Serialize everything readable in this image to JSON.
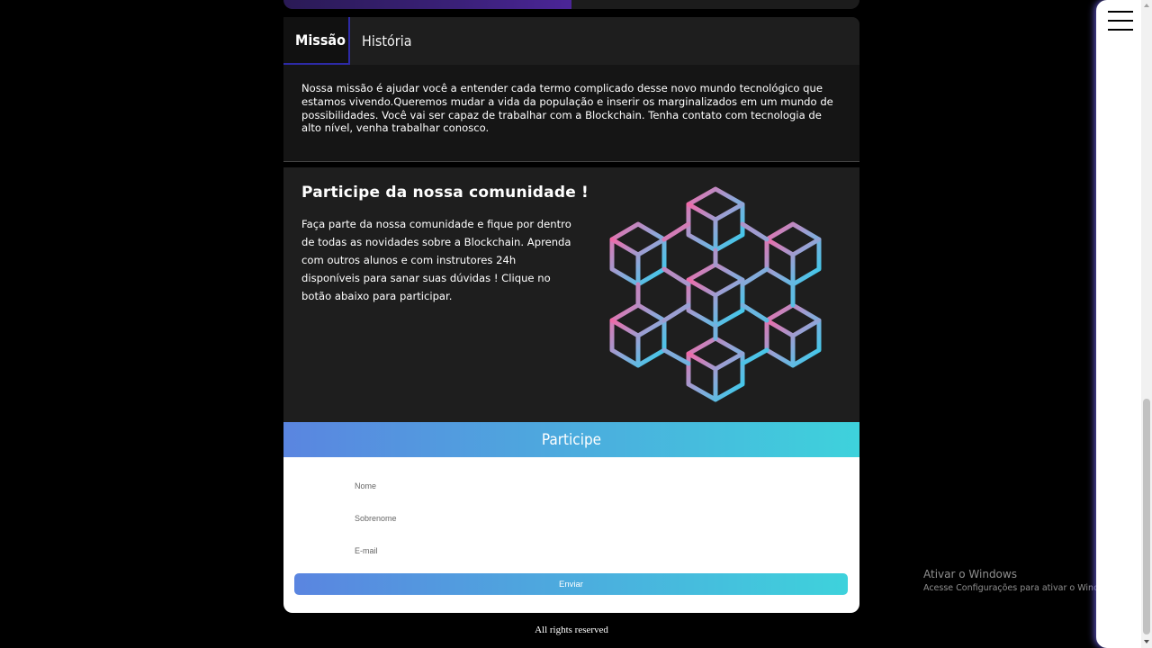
{
  "tabs": [
    {
      "label": "Missão",
      "active": true
    },
    {
      "label": "História",
      "active": false
    }
  ],
  "mission": {
    "text": "Nossa missão é ajudar você a entender cada termo complicado desse novo mundo tecnológico que estamos vivendo.Queremos mudar a vida da população e inserir os marginalizados em um mundo de possibilidades. Você vai ser capaz de trabalhar com a Blockchain. Tenha contato com tecnologia de alto nível, venha trabalhar conosco."
  },
  "community": {
    "title": "Participe da nossa comunidade !",
    "text": "Faça parte da nossa comunidade e fique por dentro de todas as novidades sobre a Blockchain. Aprenda com outros alunos e com instrutores 24h disponíveis para sanar suas dúvidas ! Clique no botão abaixo para participar.",
    "illustration_icon": "blockchain-cubes-icon"
  },
  "form": {
    "title": "Participe",
    "fields": [
      {
        "placeholder": "Nome",
        "value": ""
      },
      {
        "placeholder": "Sobrenome",
        "value": ""
      },
      {
        "placeholder": "E-mail",
        "value": ""
      }
    ],
    "submit_label": "Enviar"
  },
  "footer": {
    "text": "All rights reserved"
  },
  "menu": {
    "icon": "hamburger-menu-icon"
  },
  "watermark": {
    "line1": "Ativar o Windows",
    "line2": "Acesse Configurações para ativar o Windows."
  },
  "colors": {
    "gradient_start": "#5a85e0",
    "gradient_end": "#3ed2dc",
    "tab_accent": "#2d2aa6",
    "panel_bg": "#1e1e1e"
  }
}
